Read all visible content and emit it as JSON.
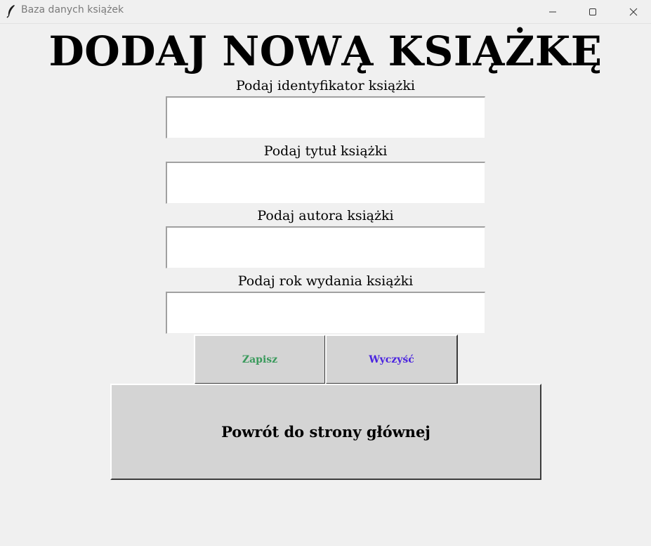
{
  "window": {
    "title": "Baza danych książek",
    "icon": "feather-icon"
  },
  "page": {
    "heading": "DODAJ NOWĄ KSIĄŻKĘ"
  },
  "form": {
    "fields": [
      {
        "label": "Podaj identyfikator książki",
        "value": ""
      },
      {
        "label": "Podaj tytuł książki",
        "value": ""
      },
      {
        "label": "Podaj autora książki",
        "value": ""
      },
      {
        "label": "Podaj rok wydania książki",
        "value": ""
      }
    ]
  },
  "buttons": {
    "save": "Zapisz",
    "clear": "Wyczyść",
    "back": "Powrót do strony głównej"
  },
  "colors": {
    "save_text": "#3a9a5c",
    "clear_text": "#4a23e0",
    "background": "#f0f0f0",
    "button_face": "#d4d4d4"
  }
}
